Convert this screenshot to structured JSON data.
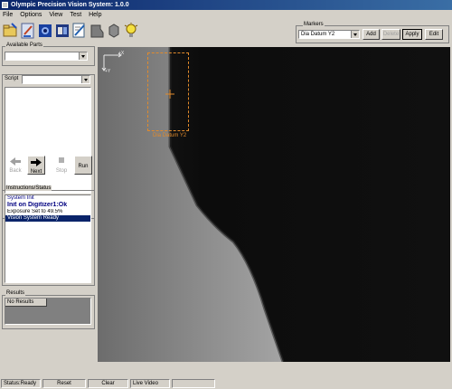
{
  "window": {
    "title": "Olympic Precision Vision System: 1.0.0"
  },
  "menu": [
    "File",
    "Options",
    "View",
    "Test",
    "Help"
  ],
  "toolbar": {
    "icons": [
      "open-folder-icon",
      "pencil-icon",
      "camera-icon",
      "camera-settings-icon",
      "edit-document-icon",
      "part-icon",
      "tool-icon",
      "lightbulb-icon"
    ]
  },
  "markers": {
    "label": "Markers",
    "selected": "Dia Datum Y2",
    "buttons": {
      "add": "Add",
      "delete": "Delete",
      "apply": "Apply",
      "edit": "Edit"
    }
  },
  "available_parts": {
    "label": "Available Parts",
    "selected": ""
  },
  "script": {
    "label": "Script",
    "selected": "",
    "buttons": {
      "back": "Back",
      "next": "Next",
      "stop": "Stop",
      "run": "Run"
    }
  },
  "instructions": {
    "label": "Instructions/Status",
    "lines": [
      "System Init",
      "Init on Digitizer1:Ok",
      "Exposure Set to   49.5%",
      "Vision System Ready"
    ]
  },
  "results": {
    "label": "Results",
    "header": "No Results"
  },
  "camera": {
    "marker_label": "Dia Datum Y2",
    "axis_x": "+X",
    "axis_y": "+Y"
  },
  "statusbar": {
    "status": "Status:Ready",
    "reset": "Reset",
    "clear": "Clear",
    "live": "Live Video",
    "extra": ""
  },
  "colors": {
    "title_start": "#0a246a",
    "title_end": "#3a6ea5",
    "selection": "#0a246a",
    "marker": "#e08a2c"
  }
}
